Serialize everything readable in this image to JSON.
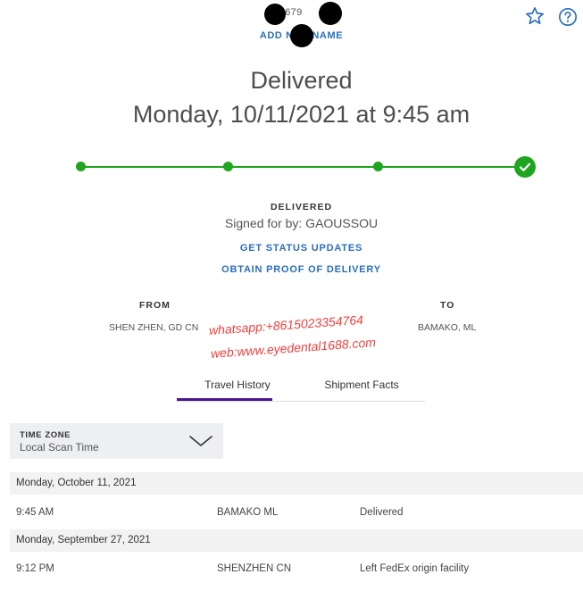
{
  "header": {
    "tracking_fragment": "200679",
    "add_nickname": "ADD NICKNAME",
    "star_icon": "star-outline-icon",
    "help_icon": "question-circle-icon"
  },
  "status": {
    "title": "Delivered",
    "date_line": "Monday, 10/11/2021 at 9:45 am",
    "progress_steps_complete": 4,
    "progress_steps_total": 4,
    "label": "DELIVERED",
    "signed_for": "Signed for by: GAOUSSOU",
    "get_updates": "GET STATUS UPDATES",
    "proof": "OBTAIN PROOF OF DELIVERY"
  },
  "route": {
    "from_label": "FROM",
    "from_value": "SHEN ZHEN, GD CN",
    "to_label": "TO",
    "to_value": "BAMAKO, ML"
  },
  "watermark": {
    "line1": "whatsapp:+8615023354764",
    "line2": "web:www.eyedental1688.com"
  },
  "tabs": {
    "travel_history": "Travel History",
    "shipment_facts": "Shipment Facts",
    "active": "travel_history"
  },
  "timezone": {
    "label": "TIME ZONE",
    "value": "Local Scan Time"
  },
  "history": [
    {
      "date": "Monday, October 11, 2021",
      "events": [
        {
          "time": "9:45 AM",
          "location": "BAMAKO ML",
          "status": "Delivered"
        }
      ]
    },
    {
      "date": "Monday, September 27, 2021",
      "events": [
        {
          "time": "9:12 PM",
          "location": "SHENZHEN CN",
          "status": "Left FedEx origin facility"
        }
      ]
    }
  ],
  "colors": {
    "accent_blue": "#2a6ebb",
    "progress_green": "#1fa51f",
    "tab_purple": "#4d148c",
    "watermark_red": "#e8231e"
  }
}
